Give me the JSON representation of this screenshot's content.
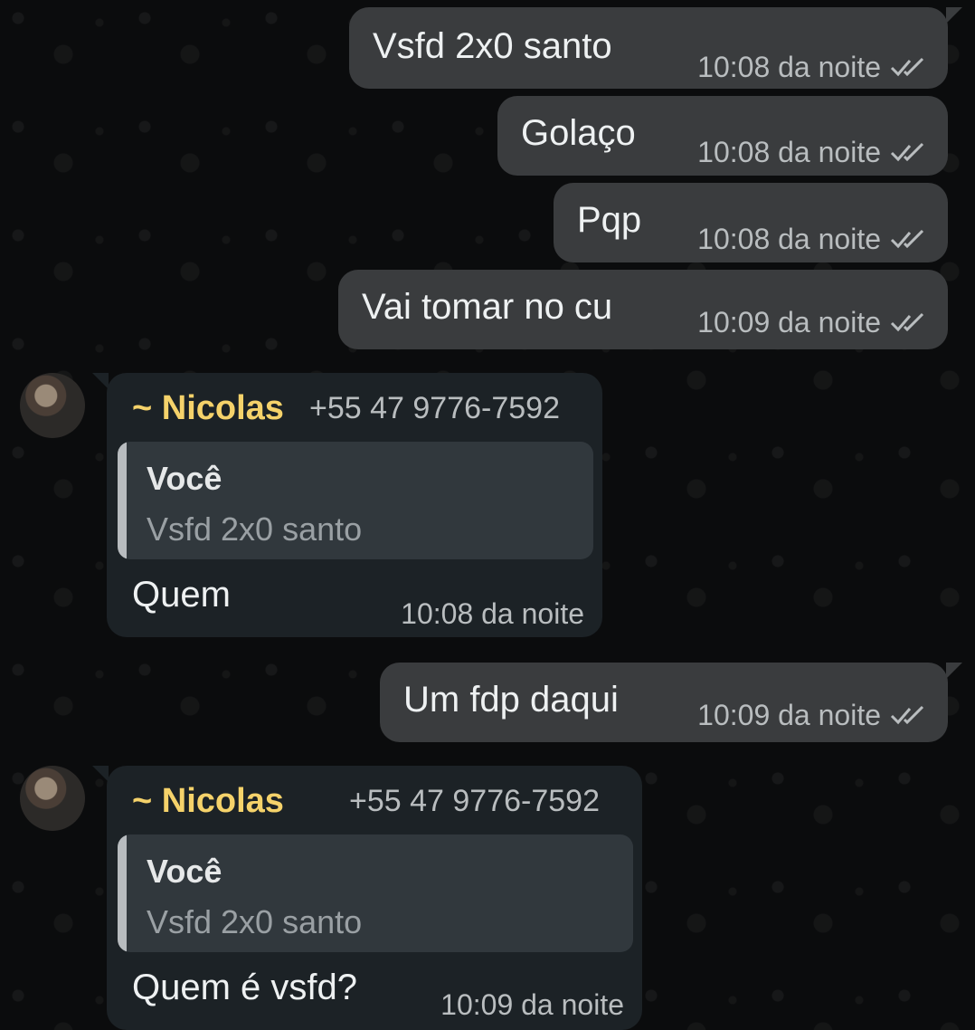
{
  "messages": {
    "m1": {
      "text": "Vsfd 2x0 santo",
      "time": "10:08 da noite"
    },
    "m2": {
      "text": "Golaço",
      "time": "10:08 da noite"
    },
    "m3": {
      "text": "Pqp",
      "time": "10:08 da noite"
    },
    "m4": {
      "text": "Vai tomar no cu",
      "time": "10:09 da noite"
    },
    "m5": {
      "sender": "~ Nicolas",
      "phone": "+55 47 9776-7592",
      "quote_author": "Você",
      "quote_text": "Vsfd 2x0 santo",
      "text": "Quem",
      "time": "10:08 da noite"
    },
    "m6": {
      "text": "Um fdp daqui",
      "time": "10:09 da noite"
    },
    "m7": {
      "sender": "~ Nicolas",
      "phone": "+55 47 9776-7592",
      "quote_author": "Você",
      "quote_text": "Vsfd 2x0 santo",
      "text": "Quem é vsfd?",
      "time": "10:09 da noite"
    }
  },
  "colors": {
    "outgoing_bubble": "#3a3c3e",
    "incoming_bubble": "#1c2226",
    "sender_name": "#f5d26a",
    "background": "#0b0c0d"
  },
  "icons": {
    "read_receipt": "double-check-icon",
    "avatar": "contact-avatar"
  }
}
